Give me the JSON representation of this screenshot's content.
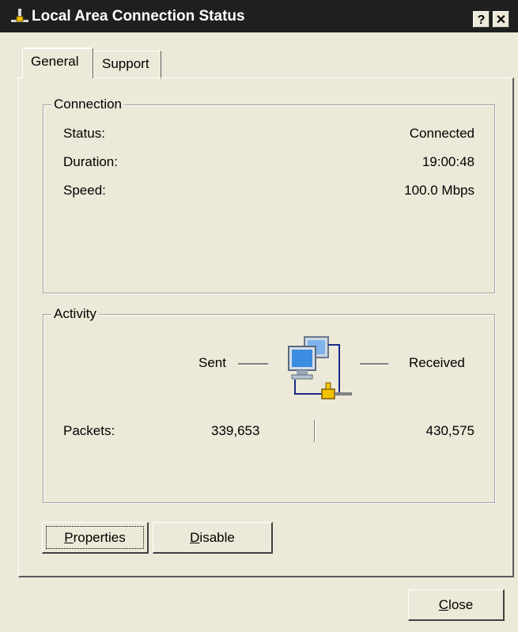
{
  "window": {
    "title": "Local Area Connection Status",
    "help_label": "?",
    "close_label": "✕"
  },
  "tabs": [
    {
      "label": "General",
      "selected": true
    },
    {
      "label": "Support",
      "selected": false
    }
  ],
  "connection": {
    "legend": "Connection",
    "rows": [
      {
        "label": "Status:",
        "value": "Connected"
      },
      {
        "label": "Duration:",
        "value": "19:00:48"
      },
      {
        "label": "Speed:",
        "value": "100.0 Mbps"
      }
    ]
  },
  "activity": {
    "legend": "Activity",
    "sent_label": "Sent",
    "received_label": "Received",
    "packets_label": "Packets:",
    "packets_sent": "339,653",
    "packets_received": "430,575",
    "icon": "network-computers-icon"
  },
  "buttons": {
    "properties_prefix": "",
    "properties_accel": "P",
    "properties_rest": "roperties",
    "disable_prefix": "",
    "disable_accel": "D",
    "disable_rest": "isable",
    "close_prefix": "",
    "close_accel": "C",
    "close_rest": "lose"
  },
  "colors": {
    "dialog_bg": "#ece9d8",
    "titlebar_bg": "#1f1f1f",
    "monitor_blue": "#3a8de0",
    "connector_yellow": "#f2c200"
  }
}
